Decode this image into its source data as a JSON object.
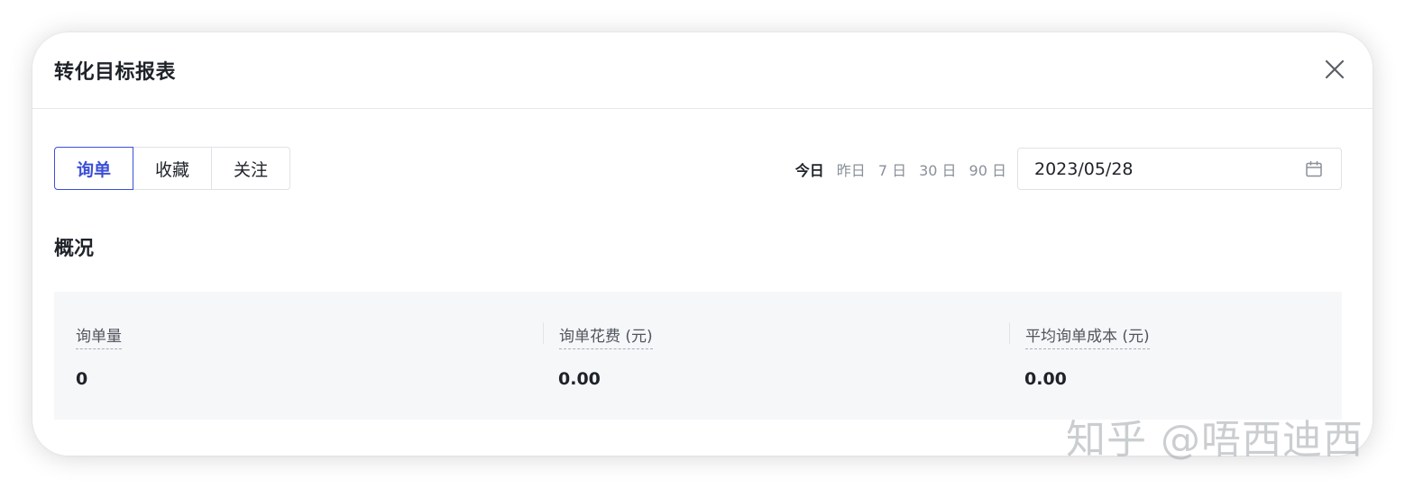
{
  "modal": {
    "title": "转化目标报表"
  },
  "tabs": [
    {
      "label": "询单",
      "active": true
    },
    {
      "label": "收藏",
      "active": false
    },
    {
      "label": "关注",
      "active": false
    }
  ],
  "quick_dates": [
    {
      "label": "今日",
      "active": true
    },
    {
      "label": "昨日",
      "active": false
    },
    {
      "label": "7 日",
      "active": false
    },
    {
      "label": "30 日",
      "active": false
    },
    {
      "label": "90 日",
      "active": false
    }
  ],
  "date_picker": {
    "value": "2023/05/28",
    "icon": "calendar-icon"
  },
  "section": {
    "title": "概况"
  },
  "metrics": [
    {
      "label": "询单量",
      "value": "0"
    },
    {
      "label": "询单花费 (元)",
      "value": "0.00"
    },
    {
      "label": "平均询单成本 (元)",
      "value": "0.00"
    }
  ],
  "watermark": "知乎 @唔西迪西",
  "colors": {
    "accent": "#3c4fd8",
    "text": "#1f2329",
    "muted": "#8a9099",
    "panel_bg": "#f6f7f9",
    "border": "#dfe2e6"
  }
}
